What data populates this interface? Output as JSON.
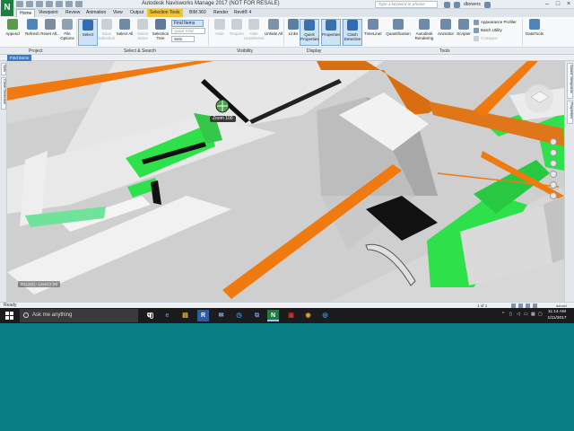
{
  "window": {
    "title": "Autodesk Navisworks Manage 2017 (NOT FOR RESALE)",
    "app_logo": "N",
    "search_placeholder": "Type a keyword or phrase",
    "user_name": "dbowers"
  },
  "tabs": [
    {
      "label": "Home",
      "active": true
    },
    {
      "label": "Viewpoint"
    },
    {
      "label": "Review"
    },
    {
      "label": "Animation"
    },
    {
      "label": "View"
    },
    {
      "label": "Output"
    },
    {
      "label": "Selection Tools",
      "context": true
    },
    {
      "label": "BIM 360"
    },
    {
      "label": "Render"
    },
    {
      "label": "Revit® 4"
    }
  ],
  "ribbon": {
    "project": {
      "append": "Append",
      "refresh": "Refresh",
      "reset_all": "Reset All...",
      "file_options": "File Options",
      "panel_label": "Project"
    },
    "select_search": {
      "select": "Select",
      "save_selection": "Save Selection",
      "select_all": "Select All",
      "select_same": "Select Same",
      "selection_tree": "Selection Tree",
      "find_items": "Find Items",
      "quick_find_placeholder": "Quick Find",
      "sets": "Sets",
      "panel_label": "Select & Search"
    },
    "visibility": {
      "hide": "Hide",
      "require": "Require",
      "hide_unselected": "Hide Unselected",
      "unhide_all": "Unhide All",
      "panel_label": "Visibility"
    },
    "display": {
      "links": "Links",
      "quick_properties": "Quick Properties",
      "properties": "Properties",
      "panel_label": "Display"
    },
    "tools": {
      "clash_detective": "Clash Detective",
      "timeliner": "TimeLiner",
      "quantification": "Quantification",
      "autodesk_rendering": "Autodesk Rendering",
      "animator": "Animator",
      "scripter": "Scripter",
      "appearance_profiler": "Appearance Profiler",
      "batch_utility": "Batch Utility",
      "compare": "Compare",
      "datatools": "DataTools",
      "panel_label": "Tools"
    }
  },
  "viewport": {
    "find_items_tab": "Find Items",
    "zoom_tooltip": "Zoom 100",
    "level_label": "B1L2(4) - Level 2 (8)"
  },
  "side_tabs": {
    "left": [
      "Sets",
      "Clash Detective"
    ],
    "right": [
      "Saved Viewpoints",
      "Properties"
    ]
  },
  "status": {
    "ready": "Ready",
    "page": "1 of 1",
    "zoom": "dshxtd"
  },
  "taskbar": {
    "search_text": "Ask me anything",
    "apps": [
      "⧉",
      "e",
      "▤",
      "R",
      "✉",
      "◷",
      "⧉",
      "N",
      "▣",
      "◉",
      "◎"
    ],
    "clock_time": "11:14 AM",
    "clock_date": "1/11/2017"
  },
  "colors": {
    "accent": "#3d78c4",
    "pipe_orange": "#f07a10",
    "duct_green": "#2ee04a",
    "desktop_teal": "#0b7f86"
  }
}
